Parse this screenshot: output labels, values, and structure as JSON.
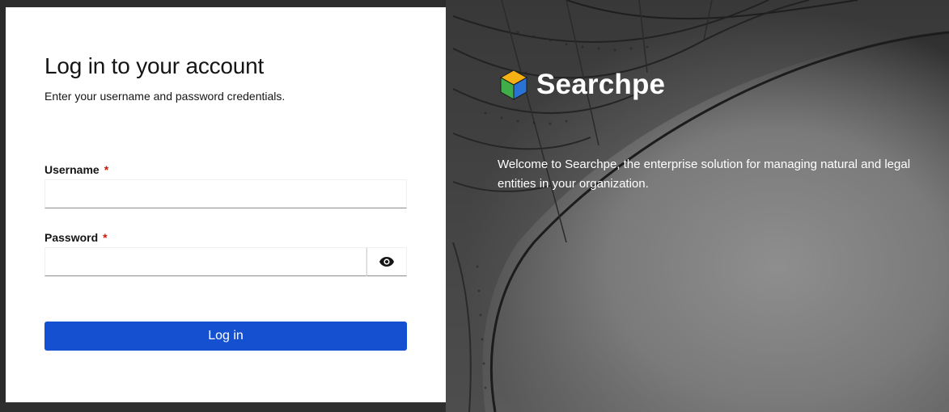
{
  "login": {
    "title": "Log in to your account",
    "subtitle": "Enter your username and password credentials.",
    "username": {
      "label": "Username",
      "required_marker": "*",
      "value": "",
      "placeholder": ""
    },
    "password": {
      "label": "Password",
      "required_marker": "*",
      "value": "",
      "placeholder": "",
      "toggle_icon": "eye-icon"
    },
    "submit_label": "Log in"
  },
  "brand": {
    "name": "Searchpe",
    "logo_icon": "cube-logo-icon",
    "welcome_text": "Welcome to Searchpe, the enterprise solution for managing natural and legal entities in your organization."
  },
  "colors": {
    "primary_button": "#1450d0",
    "required_asterisk": "#c9190b",
    "card_background": "#ffffff",
    "title_text": "#151515",
    "brand_text": "#ffffff"
  }
}
